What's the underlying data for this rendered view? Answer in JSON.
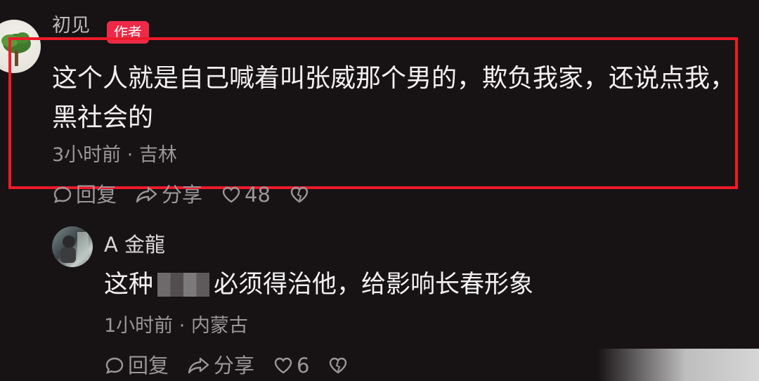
{
  "comment1": {
    "username": "初见",
    "badge": "作者",
    "text": "这个人就是自己喊着叫张威那个男的，欺负我家，还说点我，黑社会的",
    "meta": "3小时前 · 吉林",
    "actions": {
      "reply": "回复",
      "share": "分享",
      "likes": "48"
    }
  },
  "comment2": {
    "username": "A 金龍",
    "text_before": "这种",
    "text_after": "必须得治他，给影响长春形象",
    "meta": "1小时前 · 内蒙古",
    "actions": {
      "reply": "回复",
      "share": "分享",
      "likes": "6"
    }
  },
  "colors": {
    "background": "#171315",
    "highlight_box": "#ee1b2a",
    "badge": "#ee2a48"
  }
}
